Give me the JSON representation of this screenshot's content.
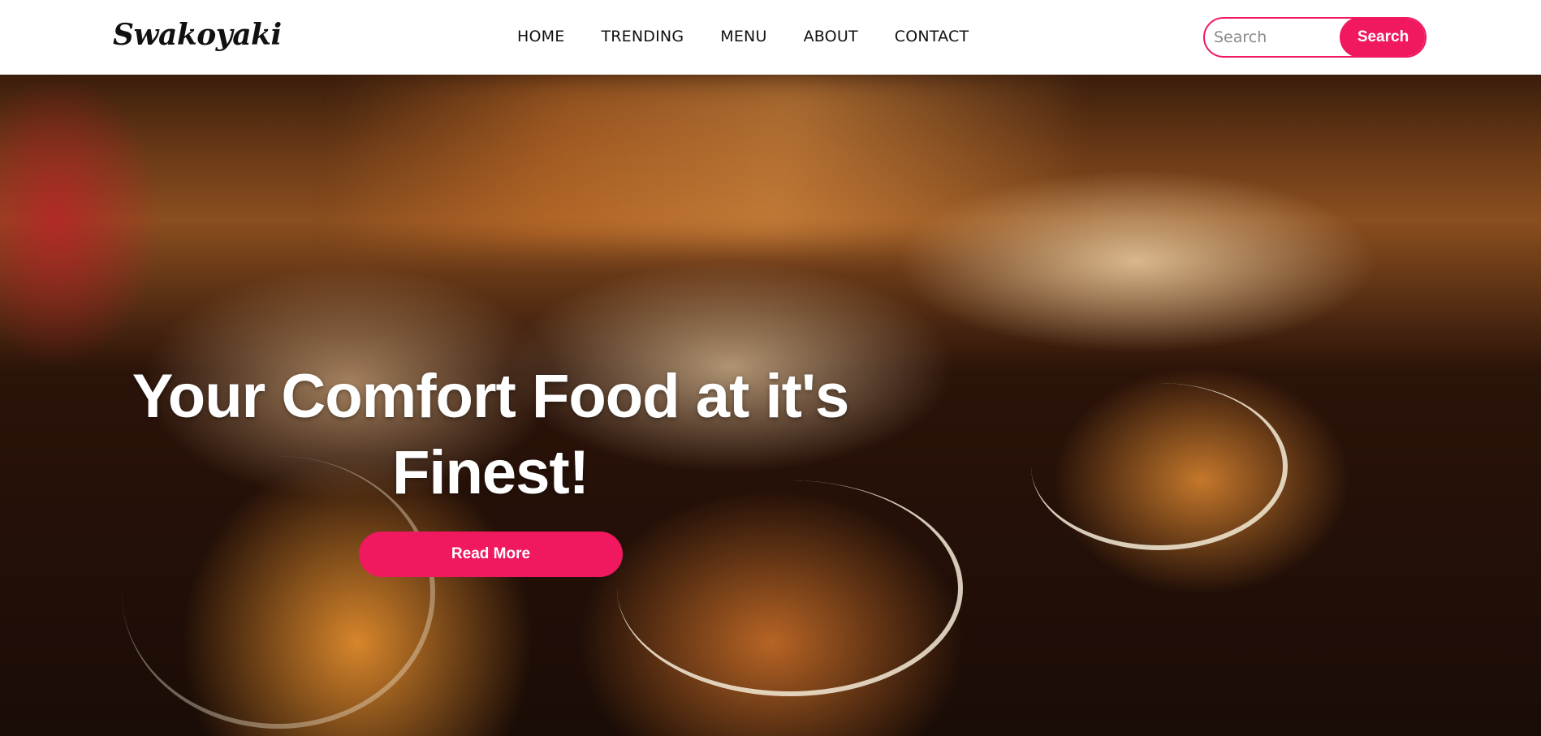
{
  "brand": {
    "name": "Swakoyaki"
  },
  "nav": {
    "items": [
      {
        "label": "HOME"
      },
      {
        "label": "TRENDING"
      },
      {
        "label": "MENU"
      },
      {
        "label": "ABOUT"
      },
      {
        "label": "CONTACT"
      }
    ]
  },
  "search": {
    "placeholder": "Search",
    "value": "",
    "button_label": "Search"
  },
  "hero": {
    "title": "Your Comfort Food at it's Finest!",
    "button_label": "Read More",
    "background_image": "takoyaki-photo"
  },
  "colors": {
    "accent": "#f0185f",
    "nav_text": "#111111",
    "hero_text": "#ffffff"
  }
}
